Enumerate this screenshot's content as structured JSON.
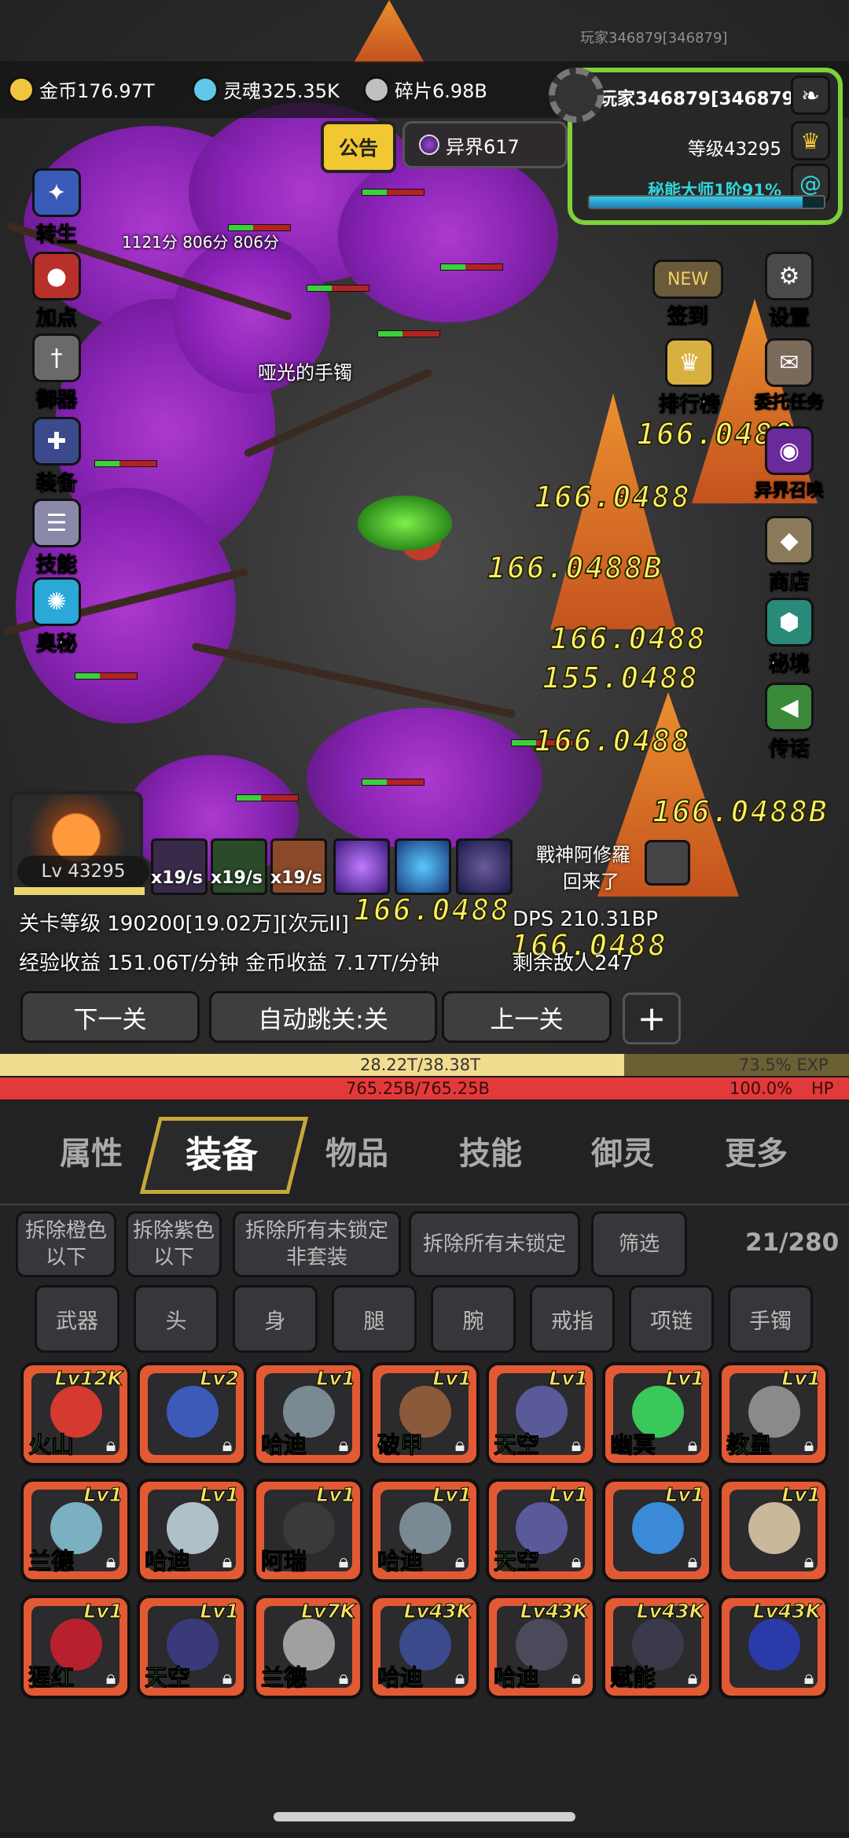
{
  "player_tag": "玩家346879[346879]",
  "resources": [
    {
      "label": "金币176.97T",
      "icon": "gold-coin-icon",
      "color": "#f0c640"
    },
    {
      "label": "灵魂325.35K",
      "icon": "soul-icon",
      "color": "#62c8e8"
    },
    {
      "label": "碎片6.98B",
      "icon": "shard-icon",
      "color": "#bfbfbf"
    }
  ],
  "profile": {
    "name": "玩家346879[346879]",
    "level": "等级43295",
    "mastery": "秘能大师1阶91%",
    "mastery_progress": 0.91
  },
  "notice_label": "公告",
  "otherworld_label": "异界617",
  "left_menu": [
    "转生",
    "加点",
    "御器",
    "装备",
    "技能",
    "奥秘"
  ],
  "right_menu": [
    "签到",
    "设置",
    "排行榜",
    "委托任务",
    "异界召唤",
    "商店",
    "秘境",
    "传话"
  ],
  "new_badge": "NEW",
  "scene_scores": "1121分 806分  806分",
  "drop_label": "哑光的手镯",
  "damage_numbers": [
    "166.0488",
    "166.0488B",
    "166.0488",
    "166.0488",
    "155.0488",
    "166.0488",
    "166.0488B",
    "166.0488",
    "166.0488"
  ],
  "hero_level": "Lv 43295",
  "skill_rates": [
    "x19/s",
    "x19/s",
    "x19/s"
  ],
  "boss_message": {
    "line1": "戰神阿修羅",
    "line2": "回来了"
  },
  "stage_info": "关卡等级 190200[19.02万][次元II]",
  "dps": "DPS 210.31BP",
  "income": "经验收益 151.06T/分钟 金币收益 7.17T/分钟",
  "enemies_left": "剩余敌人247",
  "nav": {
    "next": "下一关",
    "auto": "自动跳关:关",
    "prev": "上一关",
    "plus": "+"
  },
  "exp": {
    "text": "28.22T/38.38T",
    "pct": "73.5% EXP",
    "fill": 0.735
  },
  "hp": {
    "text": "765.25B/765.25B",
    "pct": "100.0%",
    "label": "HP"
  },
  "tabs": [
    "属性",
    "装备",
    "物品",
    "技能",
    "御灵",
    "更多"
  ],
  "actions": [
    "拆除橙色\n以下",
    "拆除紫色\n以下",
    "拆除所有未锁定\n非套装",
    "拆除所有未锁定",
    "筛选"
  ],
  "bag_count": "21/280",
  "slots": [
    "武器",
    "头",
    "身",
    "腿",
    "腕",
    "戒指",
    "项链",
    "手镯"
  ],
  "items": [
    {
      "lv": "Lv12K",
      "name": "火山",
      "color": "#d43a2e"
    },
    {
      "lv": "Lv2",
      "name": "",
      "color": "#3c5ab8"
    },
    {
      "lv": "Lv1",
      "name": "哈迪",
      "color": "#7a8a92"
    },
    {
      "lv": "Lv1",
      "name": "破甲",
      "color": "#8a5a3a"
    },
    {
      "lv": "Lv1",
      "name": "天空",
      "color": "#5a5a9a"
    },
    {
      "lv": "Lv1",
      "name": "幽冥",
      "color": "#3ac85a"
    },
    {
      "lv": "Lv1",
      "name": "教皇",
      "color": "#8a8a8a"
    },
    {
      "lv": "Lv1",
      "name": "兰德",
      "color": "#7ab0c0"
    },
    {
      "lv": "Lv1",
      "name": "哈迪",
      "color": "#b0c0c8"
    },
    {
      "lv": "Lv1",
      "name": "阿瑞",
      "color": "#3a3a3a"
    },
    {
      "lv": "Lv1",
      "name": "哈迪",
      "color": "#7a8a92"
    },
    {
      "lv": "Lv1",
      "name": "天空",
      "color": "#5a5a9a"
    },
    {
      "lv": "Lv1",
      "name": "",
      "color": "#3a8ad8"
    },
    {
      "lv": "Lv1",
      "name": "",
      "color": "#cbb89a"
    },
    {
      "lv": "Lv1",
      "name": "猩红",
      "color": "#b8202e"
    },
    {
      "lv": "Lv1",
      "name": "天空",
      "color": "#3a3a7a"
    },
    {
      "lv": "Lv7K",
      "name": "兰德",
      "color": "#a0a0a0"
    },
    {
      "lv": "Lv43K",
      "name": "哈迪",
      "color": "#3a4a8a"
    },
    {
      "lv": "Lv43K",
      "name": "哈迪",
      "color": "#4a4a5a"
    },
    {
      "lv": "Lv43K",
      "name": "赋能",
      "color": "#3a3a4a"
    },
    {
      "lv": "Lv43K",
      "name": "",
      "color": "#2a3aa8"
    }
  ]
}
